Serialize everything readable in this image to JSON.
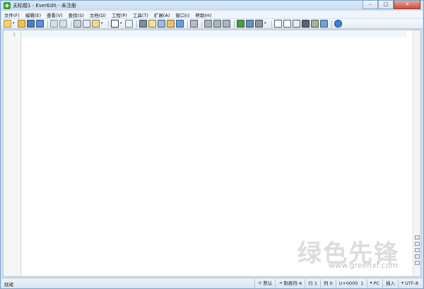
{
  "window": {
    "title": "无标题1 - EverEdit - 未注册",
    "buttons": {
      "minimize": "–",
      "maximize": "□",
      "close": "✕"
    }
  },
  "menu": [
    {
      "label": "文件(F)"
    },
    {
      "label": "编辑(E)"
    },
    {
      "label": "查看(V)"
    },
    {
      "label": "查找(S)"
    },
    {
      "label": "文档(D)"
    },
    {
      "label": "工程(P)"
    },
    {
      "label": "工具(T)"
    },
    {
      "label": "扩展(A)"
    },
    {
      "label": "窗口(I)"
    },
    {
      "label": "帮助(H)"
    }
  ],
  "toolbar": {
    "icons": [
      "new-file",
      "open-file",
      "save",
      "save-all",
      "undo",
      "redo",
      "cut",
      "copy",
      "paste",
      "view-mode",
      "outline",
      "find",
      "mark",
      "replace",
      "find-in-files",
      "share",
      "print",
      "print-preview",
      "print-setup",
      "spell-check",
      "dictionary",
      "tools",
      "split",
      "panel",
      "browser",
      "clipboard",
      "snippets",
      "help"
    ]
  },
  "editor": {
    "line_numbers": [
      "1"
    ]
  },
  "watermark": {
    "chinese": "绿色先锋",
    "url": "www.greenxf.com"
  },
  "status": {
    "ready": "就绪",
    "mode": "默认",
    "tab": "制表符:4",
    "line": "行 1",
    "col": "列 0",
    "unicode": "U+0000",
    "num": "1",
    "eol": "PC",
    "insert": "插入",
    "encoding": "UTF-8"
  },
  "colors": {
    "current_line": "#edf7fa",
    "titlebar": "#c6dcf1",
    "close_button": "#c8523c"
  }
}
